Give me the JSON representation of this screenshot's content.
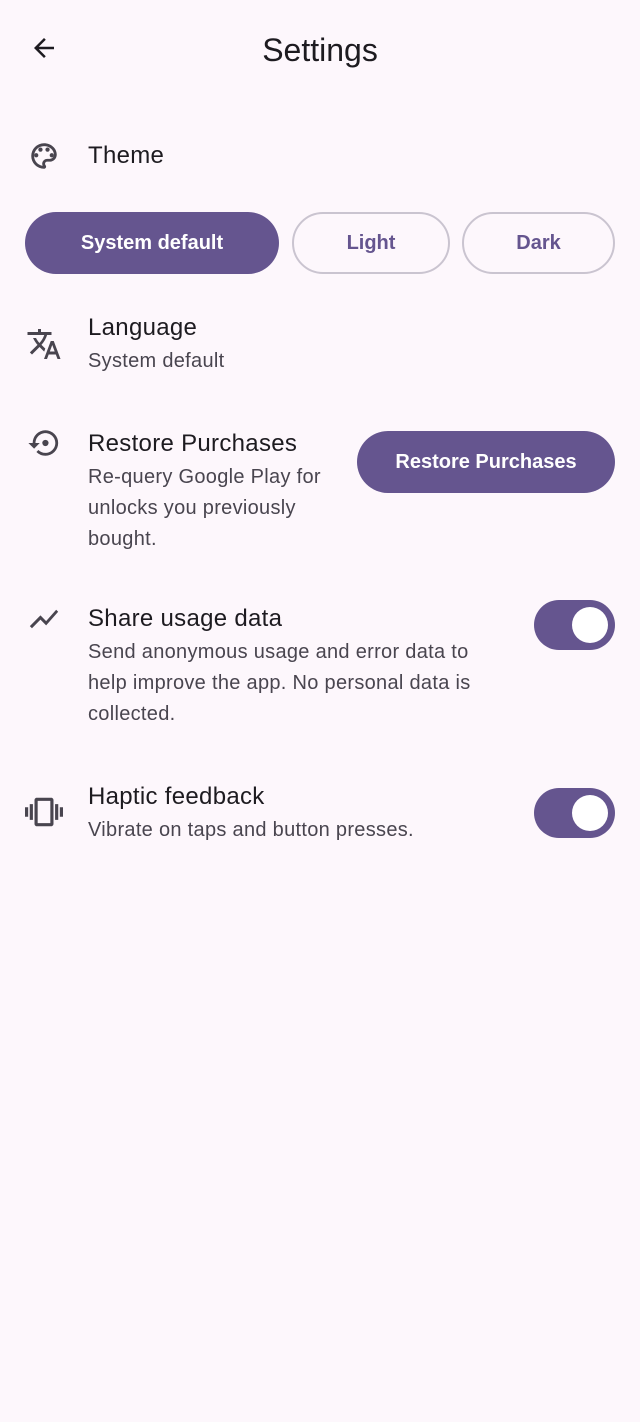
{
  "header": {
    "title": "Settings"
  },
  "theme": {
    "title": "Theme",
    "options": [
      {
        "label": "System default",
        "selected": true
      },
      {
        "label": "Light",
        "selected": false
      },
      {
        "label": "Dark",
        "selected": false
      }
    ]
  },
  "language": {
    "title": "Language",
    "subtitle": "System default"
  },
  "restore": {
    "title": "Restore Purchases",
    "subtitle_lines": [
      "Re-query Google Play for",
      "unlocks you previously",
      "bought."
    ],
    "button_label": "Restore Purchases"
  },
  "usage": {
    "title": "Share usage data",
    "subtitle_lines": [
      "Send anonymous usage and error data to",
      "help improve the app. No personal data is",
      "collected."
    ],
    "enabled": true
  },
  "haptic": {
    "title": "Haptic feedback",
    "subtitle": "Vibrate on taps and button presses.",
    "enabled": true
  },
  "colors": {
    "accent": "#65558f",
    "background": "#fdf7fc",
    "outline": "#cac4d0"
  }
}
